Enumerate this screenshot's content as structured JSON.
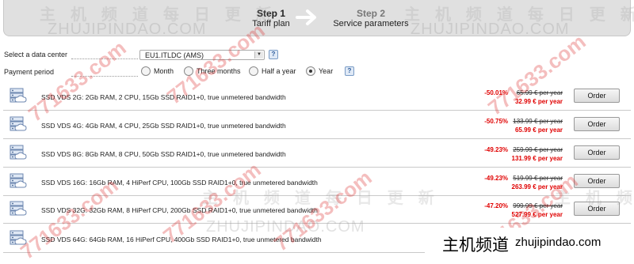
{
  "steps": [
    {
      "number": "Step 1",
      "label": "Tariff plan"
    },
    {
      "number": "Step 2",
      "label": "Service parameters"
    }
  ],
  "form": {
    "datacenter_label": "Select a data center",
    "datacenter_value": "EU1.ITLDC (AMS)",
    "payment_label": "Payment period",
    "help_glyph": "?",
    "periods": [
      {
        "label": "Month",
        "selected": false
      },
      {
        "label": "Three months",
        "selected": false
      },
      {
        "label": "Half a year",
        "selected": false
      },
      {
        "label": "Year",
        "selected": true
      }
    ]
  },
  "plans": [
    {
      "description": "SSD VDS 2G: 2Gb RAM, 2 CPU, 15Gb SSD RAID1+0, true unmetered bandwidth",
      "discount": "-50.01%",
      "old_price": "65.99 € per year",
      "new_price": "32.99 € per year",
      "button": "Order"
    },
    {
      "description": "SSD VDS 4G: 4Gb RAM, 4 CPU, 25Gb SSD RAID1+0, true unmetered bandwidth",
      "discount": "-50.75%",
      "old_price": "133.99 € per year",
      "new_price": "65.99 € per year",
      "button": "Order"
    },
    {
      "description": "SSD VDS 8G: 8Gb RAM, 8 CPU, 50Gb SSD RAID1+0, true unmetered bandwidth",
      "discount": "-49.23%",
      "old_price": "259.99 € per year",
      "new_price": "131.99 € per year",
      "button": "Order"
    },
    {
      "description": "SSD VDS 16G: 16Gb RAM, 4 HiPerf CPU, 100Gb SSD RAID1+0, true unmetered bandwidth",
      "discount": "-49.23%",
      "old_price": "519.99 € per year",
      "new_price": "263.99 € per year",
      "button": "Order"
    },
    {
      "description": "SSD VDS 32G: 32Gb RAM, 8 HiPerf CPU, 200Gb SSD RAID1+0, true unmetered bandwidth",
      "discount": "-47.20%",
      "old_price": "999.99 € per year",
      "new_price": "527.99 € per year",
      "button": "Order"
    },
    {
      "description": "SSD VDS 64G: 64Gb RAM, 16 HiPerf CPU, 400Gb SSD RAID1+0, true unmetered bandwidth"
    }
  ],
  "watermarks": {
    "chinese": "主 机 频 道  每 日 更 新",
    "site": "ZHUJIPINDAO.COM",
    "red": "771633.com"
  },
  "badge": {
    "chinese": "主机频道",
    "domain": "zhujipindao.com"
  },
  "colors": {
    "discount": "#e00000",
    "header_bg": "#e0e0e0"
  }
}
